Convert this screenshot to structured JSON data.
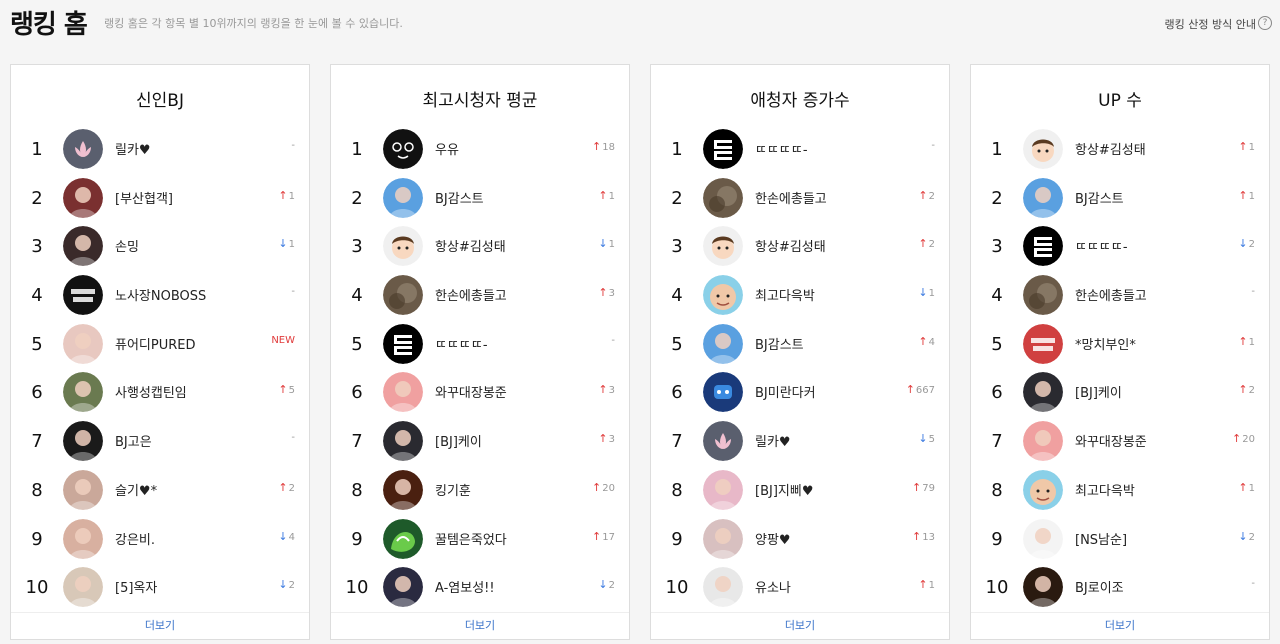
{
  "header": {
    "title": "랭킹 홈",
    "subtitle": "랭킹 홈은 각 항목 별 10위까지의 랭킹을 한 눈에 볼 수 있습니다.",
    "help_label": "랭킹 산정 방식 안내",
    "help_icon": "?"
  },
  "colors": {
    "up": "#e03b3b",
    "down": "#3b7ae0",
    "link": "#3a73c9"
  },
  "panels": [
    {
      "title": "신인BJ",
      "more": "더보기",
      "items": [
        {
          "rank": "1",
          "name": "릴카♥",
          "change": "-",
          "dir": "none",
          "avatar": "#5a5f6e",
          "mark": "lotus-icon"
        },
        {
          "rank": "2",
          "name": "[부산협객]",
          "change": "1",
          "dir": "up",
          "avatar": "#7a3030",
          "mark": "person"
        },
        {
          "rank": "3",
          "name": "손밍",
          "change": "1",
          "dir": "down",
          "avatar": "#3a2a2a",
          "mark": "person"
        },
        {
          "rank": "4",
          "name": "노사장NOBOSS",
          "change": "-",
          "dir": "none",
          "avatar": "#111111",
          "mark": "text"
        },
        {
          "rank": "5",
          "name": "퓨어디PURED",
          "change": "NEW",
          "dir": "new",
          "avatar": "#e8c8c0",
          "mark": "person"
        },
        {
          "rank": "6",
          "name": "사행성캡틴임",
          "change": "5",
          "dir": "up",
          "avatar": "#6a7a50",
          "mark": "person"
        },
        {
          "rank": "7",
          "name": "BJ고은",
          "change": "-",
          "dir": "none",
          "avatar": "#1a1a1a",
          "mark": "person"
        },
        {
          "rank": "8",
          "name": "슬기♥*",
          "change": "2",
          "dir": "up",
          "avatar": "#caa89a",
          "mark": "person"
        },
        {
          "rank": "9",
          "name": "강은비.",
          "change": "4",
          "dir": "down",
          "avatar": "#d8b0a0",
          "mark": "person"
        },
        {
          "rank": "10",
          "name": "[5]옥자",
          "change": "2",
          "dir": "down",
          "avatar": "#d8c8b8",
          "mark": "person"
        }
      ]
    },
    {
      "title": "최고시청자 평균",
      "more": "더보기",
      "items": [
        {
          "rank": "1",
          "name": "우유",
          "change": "18",
          "dir": "up",
          "avatar": "#111111",
          "mark": "face"
        },
        {
          "rank": "2",
          "name": "BJ감스트",
          "change": "1",
          "dir": "up",
          "avatar": "#5aa0e0",
          "mark": "person"
        },
        {
          "rank": "3",
          "name": "항상#김성태",
          "change": "1",
          "dir": "down",
          "avatar": "#f0f0f0",
          "mark": "cartoon"
        },
        {
          "rank": "4",
          "name": "한손에총들고",
          "change": "3",
          "dir": "up",
          "avatar": "#6a5a48",
          "mark": "blur"
        },
        {
          "rank": "5",
          "name": "ㄸㄸㄸㄸ-",
          "change": "-",
          "dir": "none",
          "avatar": "#000000",
          "mark": "glyph"
        },
        {
          "rank": "6",
          "name": "와꾸대장봉준",
          "change": "3",
          "dir": "up",
          "avatar": "#f0a0a0",
          "mark": "person"
        },
        {
          "rank": "7",
          "name": "[BJ]케이",
          "change": "3",
          "dir": "up",
          "avatar": "#2a2a30",
          "mark": "person"
        },
        {
          "rank": "8",
          "name": "킹기훈",
          "change": "20",
          "dir": "up",
          "avatar": "#4a2010",
          "mark": "person"
        },
        {
          "rank": "9",
          "name": "꿀템은죽었다",
          "change": "17",
          "dir": "up",
          "avatar": "#1e5a2a",
          "mark": "blob"
        },
        {
          "rank": "10",
          "name": "A-염보성!!",
          "change": "2",
          "dir": "down",
          "avatar": "#2a2a40",
          "mark": "person"
        }
      ]
    },
    {
      "title": "애청자 증가수",
      "more": "더보기",
      "items": [
        {
          "rank": "1",
          "name": "ㄸㄸㄸㄸ-",
          "change": "-",
          "dir": "none",
          "avatar": "#000000",
          "mark": "glyph"
        },
        {
          "rank": "2",
          "name": "한손에총들고",
          "change": "2",
          "dir": "up",
          "avatar": "#6a5a48",
          "mark": "blur"
        },
        {
          "rank": "3",
          "name": "항상#김성태",
          "change": "2",
          "dir": "up",
          "avatar": "#f0f0f0",
          "mark": "cartoon"
        },
        {
          "rank": "4",
          "name": "최고다윽박",
          "change": "1",
          "dir": "down",
          "avatar": "#8ad0e8",
          "mark": "bald"
        },
        {
          "rank": "5",
          "name": "BJ감스트",
          "change": "4",
          "dir": "up",
          "avatar": "#5aa0e0",
          "mark": "person"
        },
        {
          "rank": "6",
          "name": "BJ미란다커",
          "change": "667",
          "dir": "up",
          "avatar": "#1a3a7a",
          "mark": "logo"
        },
        {
          "rank": "7",
          "name": "릴카♥",
          "change": "5",
          "dir": "down",
          "avatar": "#5a5f6e",
          "mark": "lotus-icon"
        },
        {
          "rank": "8",
          "name": "[BJ]지삐♥",
          "change": "79",
          "dir": "up",
          "avatar": "#e8b8c8",
          "mark": "person"
        },
        {
          "rank": "9",
          "name": "양팡♥",
          "change": "13",
          "dir": "up",
          "avatar": "#d8c0c0",
          "mark": "person"
        },
        {
          "rank": "10",
          "name": "유소나",
          "change": "1",
          "dir": "up",
          "avatar": "#e8e8e8",
          "mark": "person"
        }
      ]
    },
    {
      "title": "UP 수",
      "more": "더보기",
      "items": [
        {
          "rank": "1",
          "name": "항상#김성태",
          "change": "1",
          "dir": "up",
          "avatar": "#f0f0f0",
          "mark": "cartoon"
        },
        {
          "rank": "2",
          "name": "BJ감스트",
          "change": "1",
          "dir": "up",
          "avatar": "#5aa0e0",
          "mark": "person"
        },
        {
          "rank": "3",
          "name": "ㄸㄸㄸㄸ-",
          "change": "2",
          "dir": "down",
          "avatar": "#000000",
          "mark": "glyph"
        },
        {
          "rank": "4",
          "name": "한손에총들고",
          "change": "-",
          "dir": "none",
          "avatar": "#6a5a48",
          "mark": "blur"
        },
        {
          "rank": "5",
          "name": "*망치부인*",
          "change": "1",
          "dir": "up",
          "avatar": "#d04040",
          "mark": "text"
        },
        {
          "rank": "6",
          "name": "[BJ]케이",
          "change": "2",
          "dir": "up",
          "avatar": "#2a2a30",
          "mark": "person"
        },
        {
          "rank": "7",
          "name": "와꾸대장봉준",
          "change": "20",
          "dir": "up",
          "avatar": "#f0a0a0",
          "mark": "person"
        },
        {
          "rank": "8",
          "name": "최고다윽박",
          "change": "1",
          "dir": "up",
          "avatar": "#8ad0e8",
          "mark": "bald"
        },
        {
          "rank": "9",
          "name": "[NS남순]",
          "change": "2",
          "dir": "down",
          "avatar": "#f4f4f4",
          "mark": "person"
        },
        {
          "rank": "10",
          "name": "BJ로이조",
          "change": "-",
          "dir": "none",
          "avatar": "#2a1a10",
          "mark": "person"
        }
      ]
    }
  ]
}
